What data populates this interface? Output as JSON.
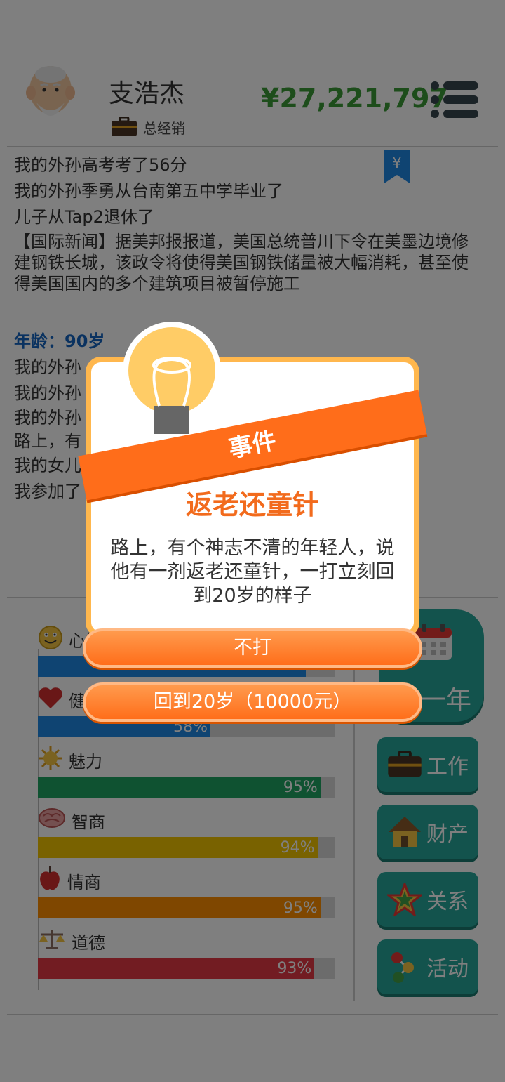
{
  "header": {
    "player_name": "支浩杰",
    "job_title": "总经销",
    "money": "¥27,221,797"
  },
  "news": {
    "lines_top": [
      "我的外孙高考考了56分",
      "我的外孙季勇从台南第五中学毕业了",
      "儿子从Tap2退休了",
      "【国际新闻】据美邦报报道，美国总统普川下令在美墨边境修建钢铁长城，该政令将使得美国钢铁储量被大幅消耗，甚至使得美国国内的多个建筑项目被暂停施工"
    ],
    "age_label": "年龄：90岁",
    "lines_after_age": [
      "我的外孙",
      "我的外孙",
      "我的外孙                                         功，即将步入大",
      "路上，有                                         童针，一打立刻",
      "我的女儿",
      "我参加了"
    ]
  },
  "stats": [
    {
      "label": "心情",
      "percent": 90,
      "color": "#1e88e5",
      "icon": "smiley-icon",
      "show_pct": ""
    },
    {
      "label": "健康",
      "percent": 58,
      "color": "#1e88e5",
      "icon": "heart-icon",
      "show_pct": "58%"
    },
    {
      "label": "魅力",
      "percent": 95,
      "color": "#1fa463",
      "icon": "sun-icon",
      "show_pct": "95%"
    },
    {
      "label": "智商",
      "percent": 94,
      "color": "#f2c500",
      "icon": "brain-icon",
      "show_pct": "94%"
    },
    {
      "label": "情商",
      "percent": 95,
      "color": "#ff8f00",
      "icon": "apple-icon",
      "show_pct": "95%"
    },
    {
      "label": "道德",
      "percent": 93,
      "color": "#e53945",
      "icon": "scales-icon",
      "show_pct": "93%"
    }
  ],
  "side_buttons": {
    "next_year": "一年",
    "work": "工作",
    "assets": "财产",
    "relations": "关系",
    "activities": "活动"
  },
  "dialog": {
    "ribbon": "事件",
    "title": "返老还童针",
    "description": "路上，有个神志不清的年轻人，说他有一剂返老还童针，一打立刻回到20岁的样子",
    "option1": "不打",
    "option2": "回到20岁（10000元）"
  },
  "colors": {
    "money": "#3a9a36",
    "accent_orange": "#ff6d1a",
    "teal": "#26a69a"
  }
}
